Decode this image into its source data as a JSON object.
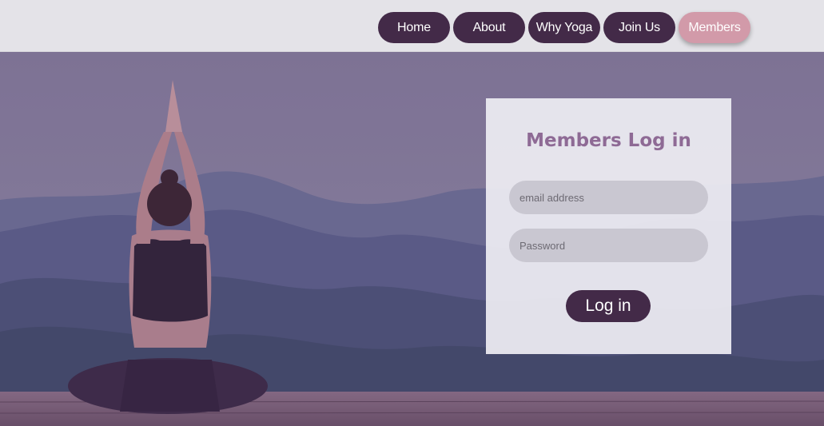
{
  "nav": {
    "items": [
      {
        "label": "Home"
      },
      {
        "label": "About"
      },
      {
        "label": "Why Yoga"
      },
      {
        "label": "Join Us"
      },
      {
        "label": "Members"
      }
    ],
    "active": "Members"
  },
  "login": {
    "title": "Members Log in",
    "email_placeholder": "email address",
    "password_placeholder": "Password",
    "submit_label": "Log in"
  },
  "colors": {
    "nav_button": "#432a48",
    "nav_active": "#d29aa9",
    "title": "#8e6a95",
    "field": "#c9c7d1"
  }
}
